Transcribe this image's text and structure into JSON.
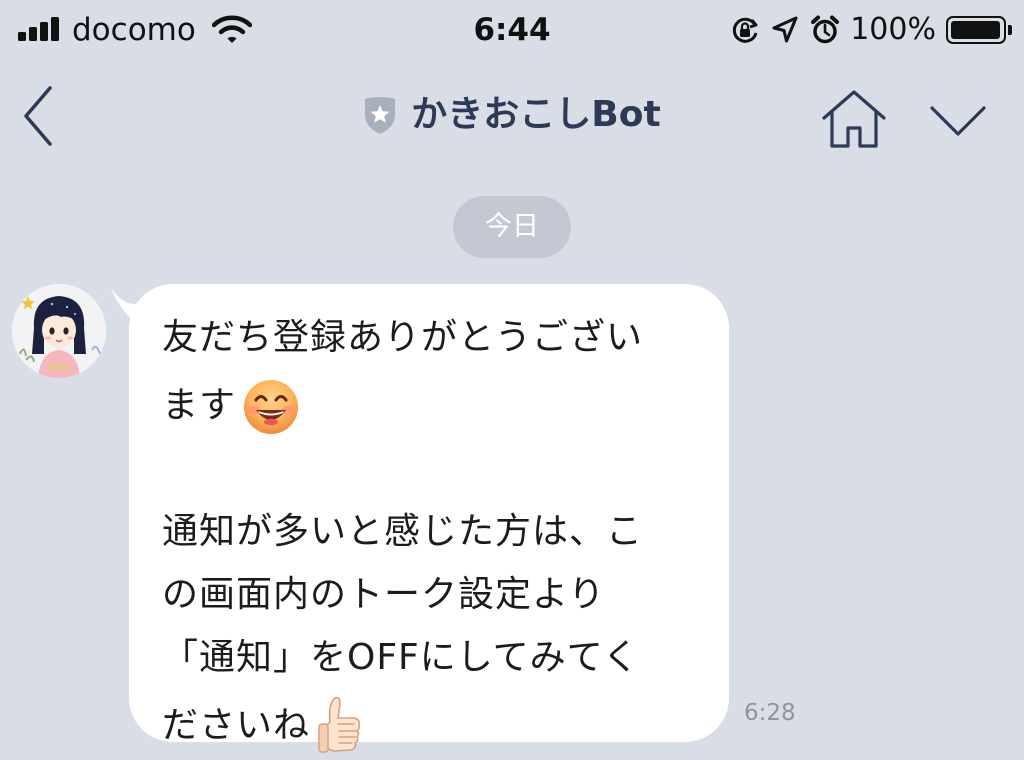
{
  "status_bar": {
    "carrier": "docomo",
    "time": "6:44",
    "battery_percent": "100%",
    "battery_level": 1.0,
    "icons": [
      "signal-icon",
      "wifi-icon",
      "orientation-lock-icon",
      "location-icon",
      "alarm-icon",
      "battery-icon"
    ]
  },
  "nav": {
    "title": "かきおこしBot",
    "icons": [
      "back-chevron-icon",
      "official-shield-icon",
      "home-icon",
      "chevron-down-icon"
    ]
  },
  "chat": {
    "date_label": "今日",
    "message": {
      "lines": [
        "友だち登録ありがとうござい",
        "ます",
        "",
        "通知が多いと感じた方は、こ",
        "の画面内のトーク設定より",
        "「通知」をOFFにしてみてく",
        "ださいね"
      ],
      "emojis": [
        "grinning-face-emoji",
        "thumbs-up-emoji"
      ],
      "time": "6:28"
    }
  },
  "colors": {
    "background": "#d9dde6",
    "bubble": "#ffffff",
    "title": "#2d3a55",
    "nav_icon": "#2d3a55",
    "date_pill": "#c3c8d2",
    "timestamp": "#8e93a0"
  }
}
